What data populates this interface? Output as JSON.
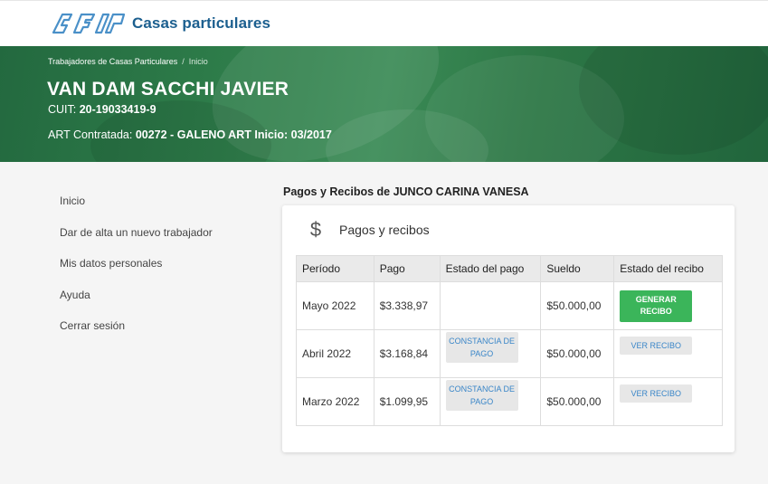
{
  "header": {
    "brand": "Casas particulares",
    "logo_icon": "afip-logo-icon"
  },
  "hero": {
    "breadcrumb": {
      "parent": "Trabajadores de Casas Particulares",
      "separator": "/",
      "current": "Inicio"
    },
    "name": "VAN DAM SACCHI JAVIER",
    "cuit_label": "CUIT:",
    "cuit_value": "20-19033419-9",
    "art_label": "ART Contratada:",
    "art_value": "00272 - GALENO ART Inicio: 03/2017"
  },
  "sidebar": {
    "items": [
      {
        "label": "Inicio"
      },
      {
        "label": "Dar de alta un nuevo trabajador"
      },
      {
        "label": "Mis datos personales"
      },
      {
        "label": "Ayuda"
      },
      {
        "label": "Cerrar sesión"
      }
    ]
  },
  "main": {
    "section_title": "Pagos y Recibos de JUNCO CARINA VANESA",
    "card": {
      "icon": "dollar-icon",
      "icon_glyph": "$",
      "title": "Pagos y recibos"
    },
    "table": {
      "headers": [
        "Período",
        "Pago",
        "Estado del pago",
        "Sueldo",
        "Estado del recibo"
      ],
      "rows": [
        {
          "periodo": "Mayo 2022",
          "pago": "$3.338,97",
          "estado_pago": "",
          "sueldo": "$50.000,00",
          "recibo_action": "GENERAR RECIBO"
        },
        {
          "periodo": "Abril 2022",
          "pago": "$3.168,84",
          "estado_pago": "CONSTANCIA DE PAGO",
          "sueldo": "$50.000,00",
          "recibo_action": "VER RECIBO"
        },
        {
          "periodo": "Marzo 2022",
          "pago": "$1.099,95",
          "estado_pago": "CONSTANCIA DE PAGO",
          "sueldo": "$50.000,00",
          "recibo_action": "VER RECIBO"
        }
      ]
    }
  },
  "colors": {
    "brand_blue": "#1c5f8f",
    "hero_green": "#2e7d4a",
    "primary_button": "#3bb55a",
    "link_blue": "#3a86c8"
  }
}
